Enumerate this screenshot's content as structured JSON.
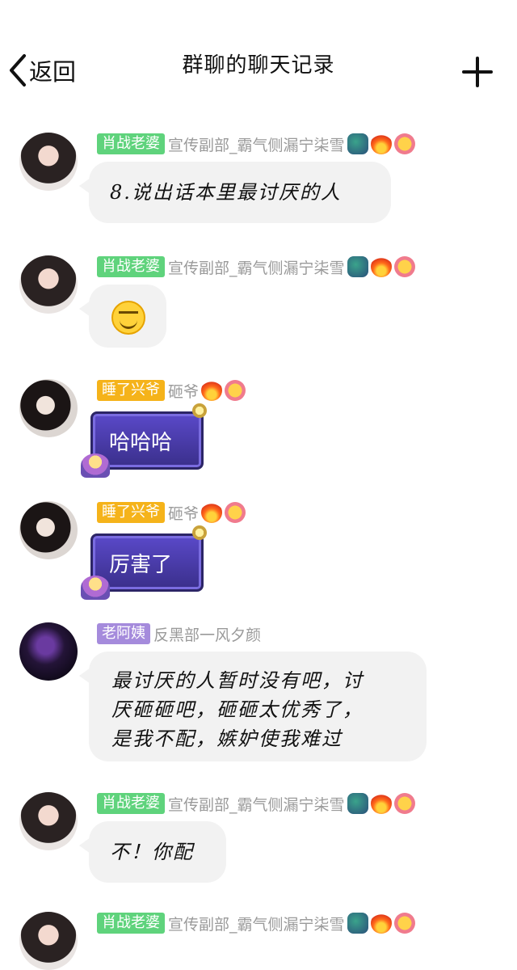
{
  "nav": {
    "back_label": "返回",
    "title": "群聊的聊天记录"
  },
  "messages": [
    {
      "badge": "肖战老婆",
      "nick": "宣传副部_霸气侧漏宁柒雪",
      "text": "8.说出话本里最讨厌的人"
    },
    {
      "badge": "肖战老婆",
      "nick": "宣传副部_霸气侧漏宁柒雪"
    },
    {
      "badge": "睡了兴爷",
      "nick": "砸爷",
      "text": "哈哈哈"
    },
    {
      "badge": "睡了兴爷",
      "nick": "砸爷",
      "text": "厉害了"
    },
    {
      "badge": "老阿姨",
      "nick": "反黑部一风夕颜",
      "lines": [
        "最讨厌的人暂时没有吧，讨",
        "厌砸砸吧，砸砸太优秀了，",
        "是我不配，嫉妒使我难过"
      ]
    },
    {
      "badge": "肖战老婆",
      "nick": "宣传副部_霸气侧漏宁柒雪",
      "text": "不！你配"
    },
    {
      "badge": "肖战老婆",
      "nick": "宣传副部_霸气侧漏宁柒雪"
    }
  ]
}
